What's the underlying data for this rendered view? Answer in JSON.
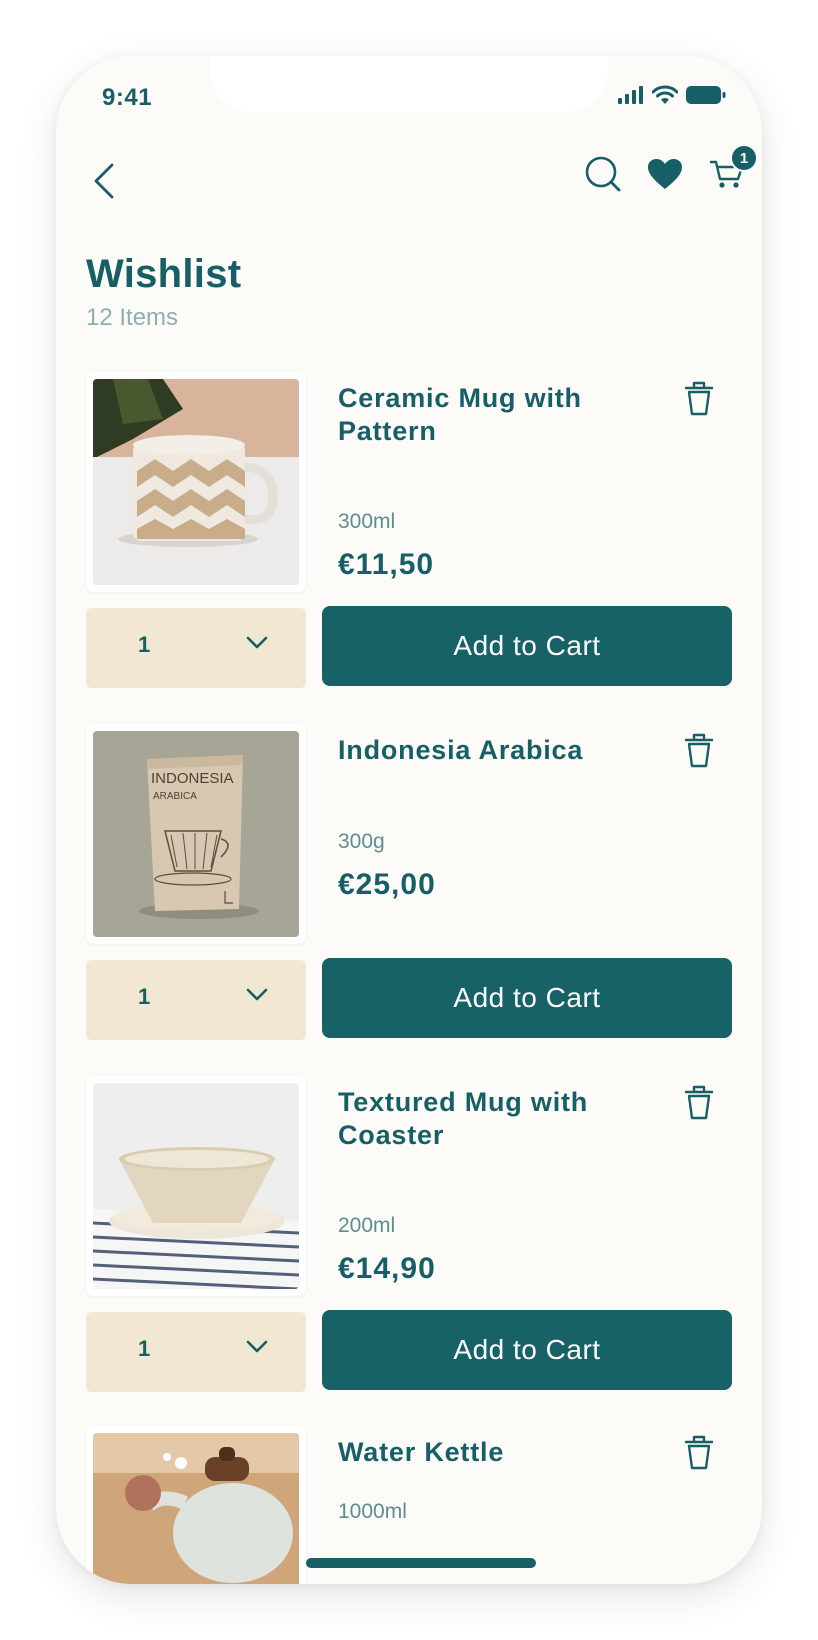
{
  "status": {
    "time": "9:41"
  },
  "header": {
    "cart_count": "1"
  },
  "page": {
    "title": "Wishlist",
    "count_label": "12 Items"
  },
  "items": [
    {
      "name": "Ceramic Mug with Pattern",
      "size": "300ml",
      "price": "€11,50",
      "qty": "1",
      "cta": "Add to Cart"
    },
    {
      "name": "Indonesia Arabica",
      "size": "300g",
      "price": "€25,00",
      "qty": "1",
      "cta": "Add to Cart",
      "package_text_1": "INDONESIA",
      "package_text_2": "ARABICA"
    },
    {
      "name": "Textured Mug with Coaster",
      "size": "200ml",
      "price": "€14,90",
      "qty": "1",
      "cta": "Add to Cart"
    },
    {
      "name": "Water Kettle",
      "size": "1000ml"
    }
  ],
  "colors": {
    "brand": "#175f67",
    "background": "#fcfbf7",
    "qty_bg": "#f1e7d3",
    "muted": "#8eb0b2"
  },
  "icons": [
    "back-chevron-icon",
    "search-icon",
    "heart-icon",
    "cart-icon",
    "trash-icon",
    "chevron-down-icon",
    "signal-icon",
    "wifi-icon",
    "battery-icon"
  ]
}
